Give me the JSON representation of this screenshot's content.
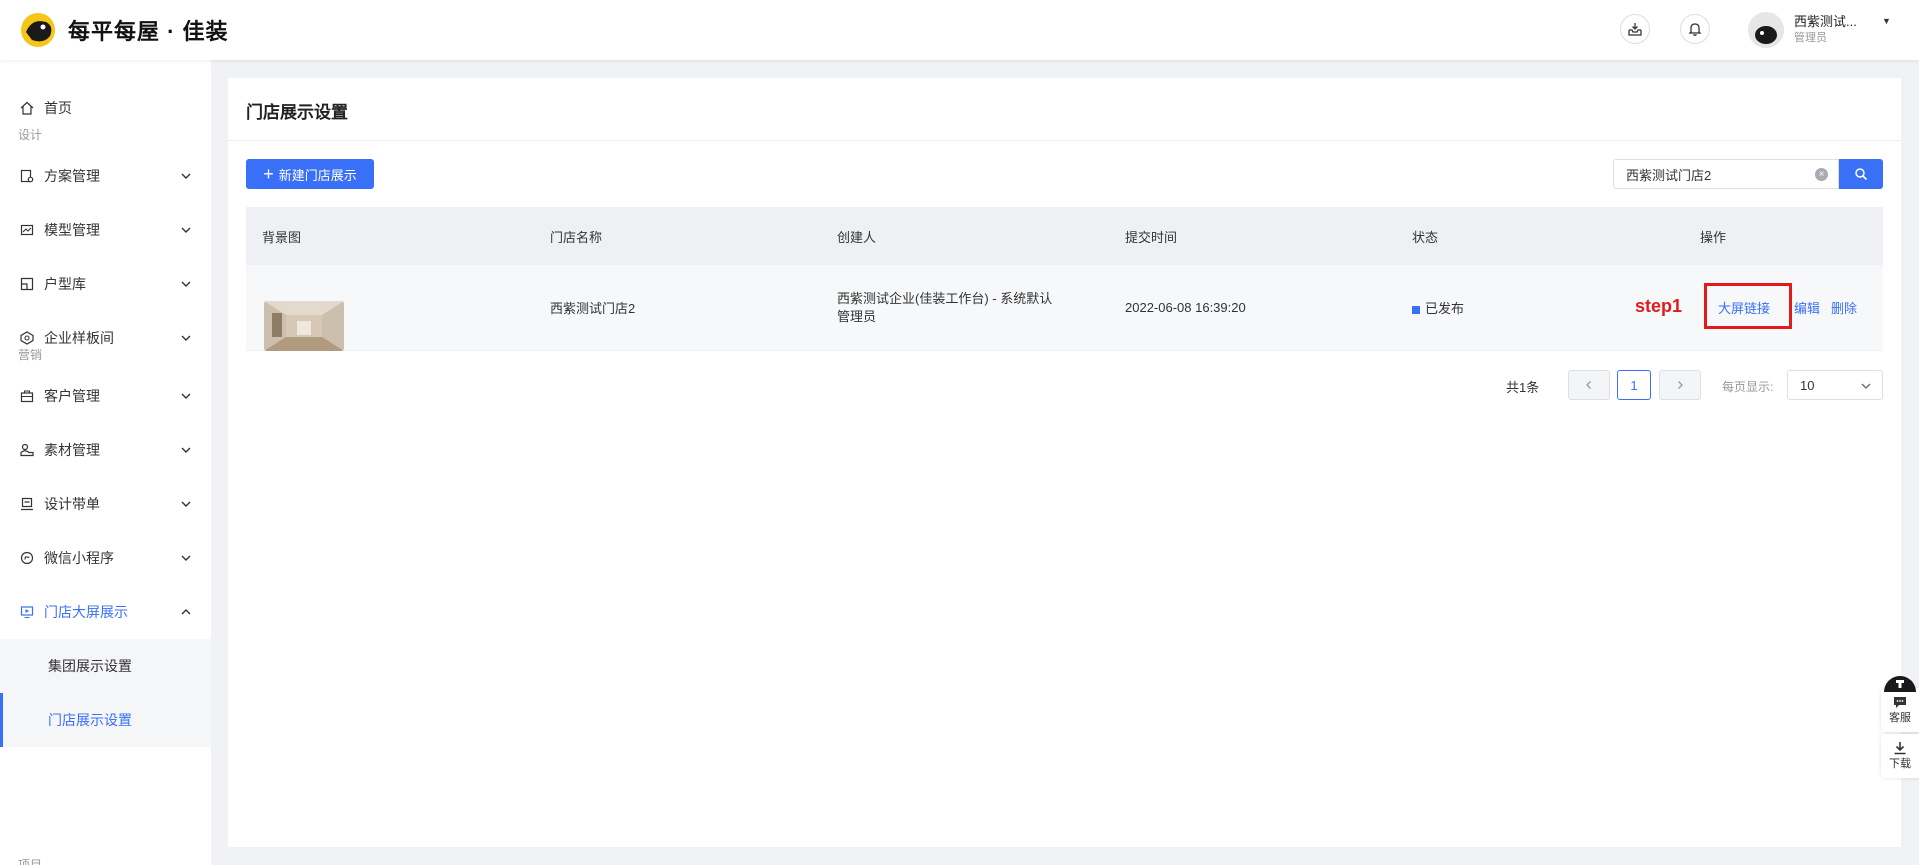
{
  "app": {
    "brand": "每平每屋 · 佳装",
    "brand_color": "#3a6ff7",
    "header_icons": [
      "inbox-icon",
      "bell-icon"
    ],
    "user": {
      "name": "西紫测试...",
      "role": "管理员"
    }
  },
  "sidebar": {
    "home": "首页",
    "groups": {
      "design": "设计",
      "marketing": "营销",
      "project": "项目"
    },
    "items": [
      {
        "label": "方案管理",
        "icon": "plan-icon"
      },
      {
        "label": "模型管理",
        "icon": "model-icon"
      },
      {
        "label": "户型库",
        "icon": "floorplan-icon"
      },
      {
        "label": "企业样板间",
        "icon": "showroom-icon"
      },
      {
        "label": "客户管理",
        "icon": "customer-icon"
      },
      {
        "label": "素材管理",
        "icon": "material-icon"
      },
      {
        "label": "设计带单",
        "icon": "order-icon"
      },
      {
        "label": "微信小程序",
        "icon": "miniprogram-icon"
      },
      {
        "label": "门店大屏展示",
        "icon": "screen-icon"
      }
    ],
    "sub_items": [
      "集团展示设置",
      "门店展示设置"
    ]
  },
  "page": {
    "title": "门店展示设置",
    "new_button": "新建门店展示",
    "search": {
      "value": "西紫测试门店2",
      "placeholder": ""
    }
  },
  "table": {
    "columns": [
      "背景图",
      "门店名称",
      "创建人",
      "提交时间",
      "状态",
      "操作"
    ],
    "rows": [
      {
        "name": "西紫测试门店2",
        "creator": "西紫测试企业(佳装工作台) - 系统默认管理员",
        "time": "2022-06-08 16:39:20",
        "status": "已发布",
        "actions": [
          "大屏链接",
          "编辑",
          "删除"
        ]
      }
    ]
  },
  "annotation": {
    "step": "step1"
  },
  "pagination": {
    "total": "共1条",
    "current": "1",
    "page_size_label": "每页显示:",
    "page_size": "10"
  },
  "float_tools": {
    "service": "客服",
    "download": "下载"
  }
}
